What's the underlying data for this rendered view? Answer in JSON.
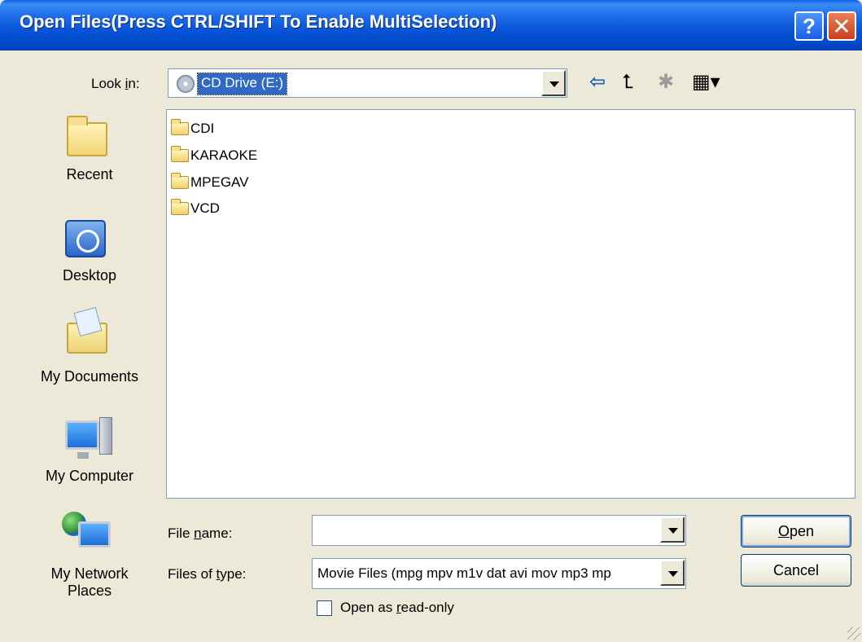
{
  "title": "Open Files(Press CTRL/SHIFT To Enable MultiSelection)",
  "titlebar_buttons": {
    "help": "?",
    "close": "✕"
  },
  "lookin": {
    "label_pre": "Look ",
    "label_u": "i",
    "label_post": "n:",
    "value": "CD Drive (E:)"
  },
  "toolbar": {
    "back_icon": "⇦",
    "up_icon": "⮤",
    "new_folder_icon": "✱",
    "view_icon": "▦▾"
  },
  "places": [
    {
      "label": "Recent",
      "icon": "recent-folder-icon"
    },
    {
      "label": "Desktop",
      "icon": "desktop-icon"
    },
    {
      "label": "My Documents",
      "icon": "my-documents-icon"
    },
    {
      "label": "My Computer",
      "icon": "my-computer-icon"
    },
    {
      "label": "My Network Places",
      "icon": "my-network-places-icon"
    }
  ],
  "files": [
    {
      "name": "CDI"
    },
    {
      "name": "KARAOKE"
    },
    {
      "name": "MPEGAV"
    },
    {
      "name": "VCD"
    }
  ],
  "filename": {
    "label_pre": "File ",
    "label_u": "n",
    "label_post": "ame:",
    "value": ""
  },
  "filetype": {
    "label_pre": "Files of ",
    "label_u": "t",
    "label_post": "ype:",
    "value": "Movie Files (mpg mpv m1v dat avi mov mp3 mp"
  },
  "buttons": {
    "open_u": "O",
    "open_rest": "pen",
    "cancel": "Cancel"
  },
  "readonly": {
    "label_pre": "Open as ",
    "label_u": "r",
    "label_post": "ead-only",
    "checked": false
  }
}
